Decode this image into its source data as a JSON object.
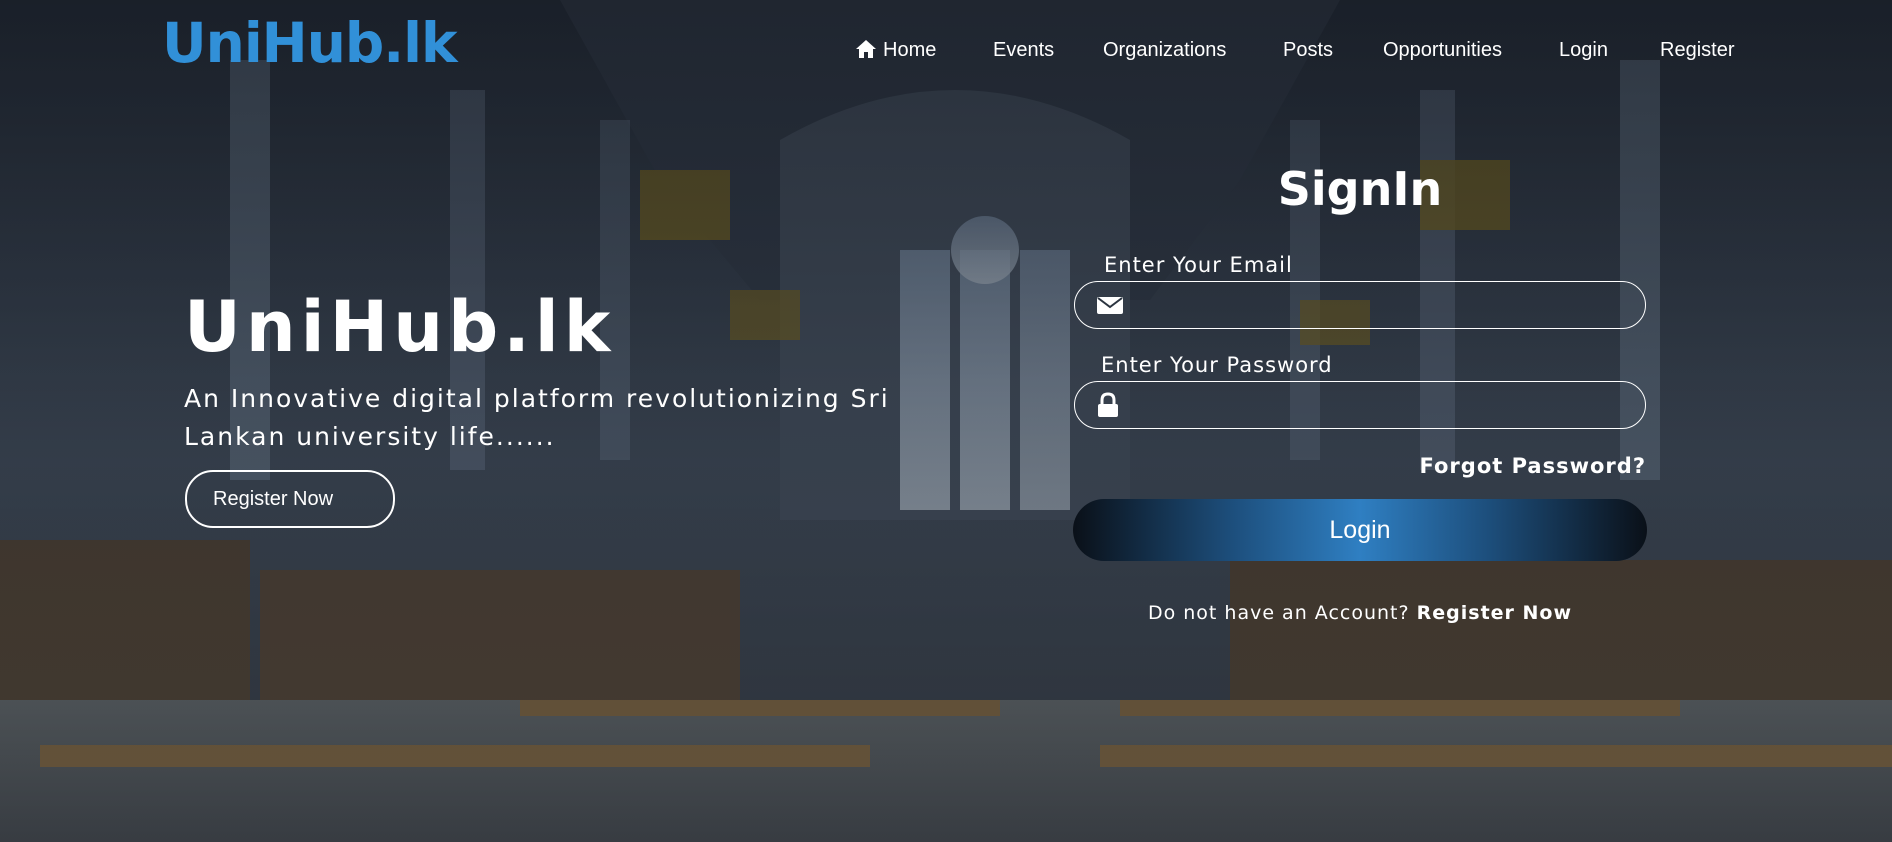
{
  "brand": {
    "logo": "UniHub.lk",
    "color": "#3190d8"
  },
  "nav": {
    "items": [
      {
        "label": "Home",
        "icon": "home-icon"
      },
      {
        "label": "Events"
      },
      {
        "label": "Organizations"
      },
      {
        "label": "Posts"
      },
      {
        "label": "Opportunities"
      },
      {
        "label": "Login"
      },
      {
        "label": "Register"
      }
    ]
  },
  "hero": {
    "title": "UniHub.lk",
    "subtitle": "An Innovative digital platform revolutionizing Sri Lankan university life......",
    "button_label": "Register Now"
  },
  "signin": {
    "title": "SignIn",
    "email_label": "Enter Your Email",
    "email_value": "",
    "email_icon": "envelope-icon",
    "password_label": "Enter Your Password",
    "password_value": "",
    "password_icon": "lock-icon",
    "forgot_label": "Forgot Password?",
    "login_label": "Login",
    "no_account_text": "Do not have an Account?",
    "register_link": "Register Now"
  },
  "colors": {
    "accent": "#3190d8",
    "text": "#ffffff",
    "login_gradient_mid": "#2f7fc2"
  }
}
